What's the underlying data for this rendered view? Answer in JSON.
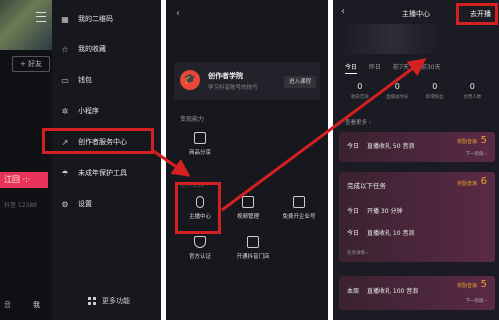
{
  "colors": {
    "highlight": "#d42020",
    "reward": "#f0a030",
    "live_tag": "#e8335a"
  },
  "panel1": {
    "add_friend": "+ 好友",
    "live_tag": "江回 ·:·",
    "user_id": "抖音 12389",
    "bottom_left": "音",
    "bottom_mid": "我",
    "menu_items": [
      {
        "label": "我的二维码",
        "icon": "qr-code-icon"
      },
      {
        "label": "我的收藏",
        "icon": "star-icon"
      },
      {
        "label": "钱包",
        "icon": "wallet-icon"
      },
      {
        "label": "小程序",
        "icon": "mini-program-icon"
      },
      {
        "label": "创作者服务中心",
        "icon": "chart-icon"
      },
      {
        "label": "未成年保护工具",
        "icon": "umbrella-icon"
      },
      {
        "label": "设置",
        "icon": "gear-icon"
      }
    ],
    "more_functions": "更多功能"
  },
  "panel2": {
    "back": "‹",
    "academy_title": "创作者学院",
    "academy_sub": "学习抖音账号的技巧",
    "enter_course": "进入课程",
    "section_ability": "变现能力",
    "goods_share": "商品分享",
    "section_tools": "创作工具",
    "tools": [
      "主播中心",
      "视频管理",
      "免费开企业号",
      "官方认证",
      "开通抖音门店"
    ]
  },
  "panel3": {
    "back": "‹",
    "title": "主播中心",
    "go_live": "去开播",
    "tabs": [
      "今日",
      "昨日",
      "前7天",
      "前30天"
    ],
    "stats": [
      {
        "value": "0",
        "label": "收获音浪"
      },
      {
        "value": "0",
        "label": "直播总时长"
      },
      {
        "value": "0",
        "label": "新增粉丝"
      },
      {
        "value": "0",
        "label": "付费人数"
      }
    ],
    "more_data": "查看更多 ›",
    "task1": {
      "day": "今日",
      "text": "直播收礼 50 音浪",
      "reward": "奖励音浪",
      "amount": "5",
      "next": "下一阶段 ›"
    },
    "task2": {
      "header": "完成以下任务",
      "reward": "奖励音浪",
      "amount": "6",
      "rows": [
        {
          "day": "今日",
          "text": "开播 30 分钟"
        },
        {
          "day": "今日",
          "text": "直播收礼 10 音浪"
        }
      ],
      "detail": "任务详情 ›"
    },
    "task3": {
      "day": "本周",
      "text": "直播收礼 100 音浪",
      "reward": "奖励音浪",
      "amount": "5",
      "next": "下一阶段 ›"
    }
  }
}
